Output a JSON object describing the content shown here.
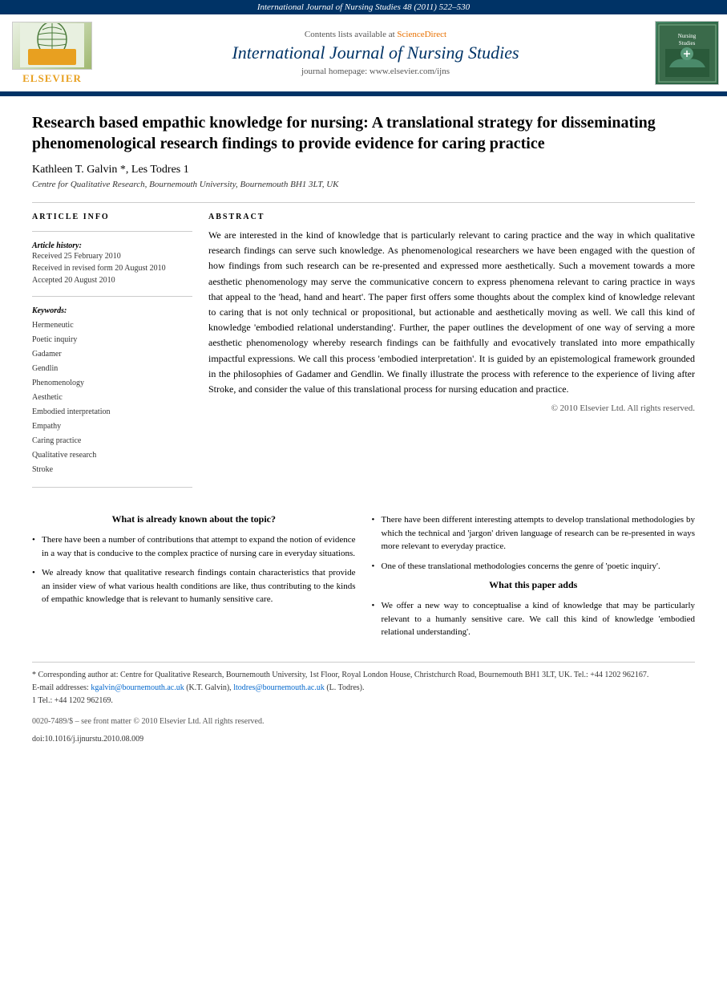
{
  "banner": {
    "text": "International Journal of Nursing Studies 48 (2011) 522–530"
  },
  "header": {
    "content_available": "Contents lists available at",
    "sciencedirect": "ScienceDirect",
    "journal_title": "International Journal of Nursing Studies",
    "homepage_label": "journal homepage:",
    "homepage_url": "www.elsevier.com/ijns",
    "elsevier_label": "ELSEVIER"
  },
  "article": {
    "title": "Research based empathic knowledge for nursing: A translational strategy for disseminating phenomenological research findings to provide evidence for caring practice",
    "authors": "Kathleen T. Galvin *, Les Todres 1",
    "affiliation": "Centre for Qualitative Research, Bournemouth University, Bournemouth BH1 3LT, UK",
    "article_info_label": "ARTICLE INFO",
    "abstract_label": "ABSTRACT",
    "history_label": "Article history:",
    "received": "Received 25 February 2010",
    "revised": "Received in revised form 20 August 2010",
    "accepted": "Accepted 20 August 2010",
    "keywords_label": "Keywords:",
    "keywords": [
      "Hermeneutic",
      "Poetic inquiry",
      "Gadamer",
      "Gendlin",
      "Phenomenology",
      "Aesthetic",
      "Embodied interpretation",
      "Empathy",
      "Caring practice",
      "Qualitative research",
      "Stroke"
    ],
    "abstract": "We are interested in the kind of knowledge that is particularly relevant to caring practice and the way in which qualitative research findings can serve such knowledge. As phenomenological researchers we have been engaged with the question of how findings from such research can be re-presented and expressed more aesthetically. Such a movement towards a more aesthetic phenomenology may serve the communicative concern to express phenomena relevant to caring practice in ways that appeal to the 'head, hand and heart'. The paper first offers some thoughts about the complex kind of knowledge relevant to caring that is not only technical or propositional, but actionable and aesthetically moving as well. We call this kind of knowledge 'embodied relational understanding'. Further, the paper outlines the development of one way of serving a more aesthetic phenomenology whereby research findings can be faithfully and evocatively translated into more empathically impactful expressions. We call this process 'embodied interpretation'. It is guided by an epistemological framework grounded in the philosophies of Gadamer and Gendlin. We finally illustrate the process with reference to the experience of living after Stroke, and consider the value of this translational process for nursing education and practice.",
    "copyright": "© 2010 Elsevier Ltd. All rights reserved."
  },
  "boxes": {
    "left_title": "What is already known about the topic?",
    "left_bullets": [
      "There have been a number of contributions that attempt to expand the notion of evidence in a way that is conducive to the complex practice of nursing care in everyday situations.",
      "We already know that qualitative research findings contain characteristics that provide an insider view of what various health conditions are like, thus contributing to the kinds of empathic knowledge that is relevant to humanly sensitive care."
    ],
    "right_title": "What this paper adds",
    "right_bullets_section1_label": "",
    "right_bullet1": "There have been different interesting attempts to develop translational methodologies by which the technical and 'jargon' driven language of research can be re-presented in ways more relevant to everyday practice.",
    "right_bullet2": "One of these translational methodologies concerns the genre of 'poetic inquiry'.",
    "right_section2_title": "What this paper adds",
    "right_bullet3": "We offer a new way to conceptualise a kind of knowledge that may be particularly relevant to a humanly sensitive care. We call this kind of knowledge 'embodied relational understanding'."
  },
  "footnotes": {
    "corresponding": "* Corresponding author at: Centre for Qualitative Research, Bournemouth University, 1st Floor, Royal London House, Christchurch Road, Bournemouth BH1 3LT, UK. Tel.: +44 1202 962167.",
    "email_label": "E-mail addresses:",
    "email1": "kgalvin@bournemouth.ac.uk",
    "email1_name": "(K.T. Galvin),",
    "email2": "ltodres@bournemouth.ac.uk",
    "email2_name": "(L. Todres).",
    "tel2": "1 Tel.: +44 1202 962169.",
    "issn": "0020-7489/$ – see front matter © 2010 Elsevier Ltd. All rights reserved.",
    "doi": "doi:10.1016/j.ijnurstu.2010.08.009"
  }
}
